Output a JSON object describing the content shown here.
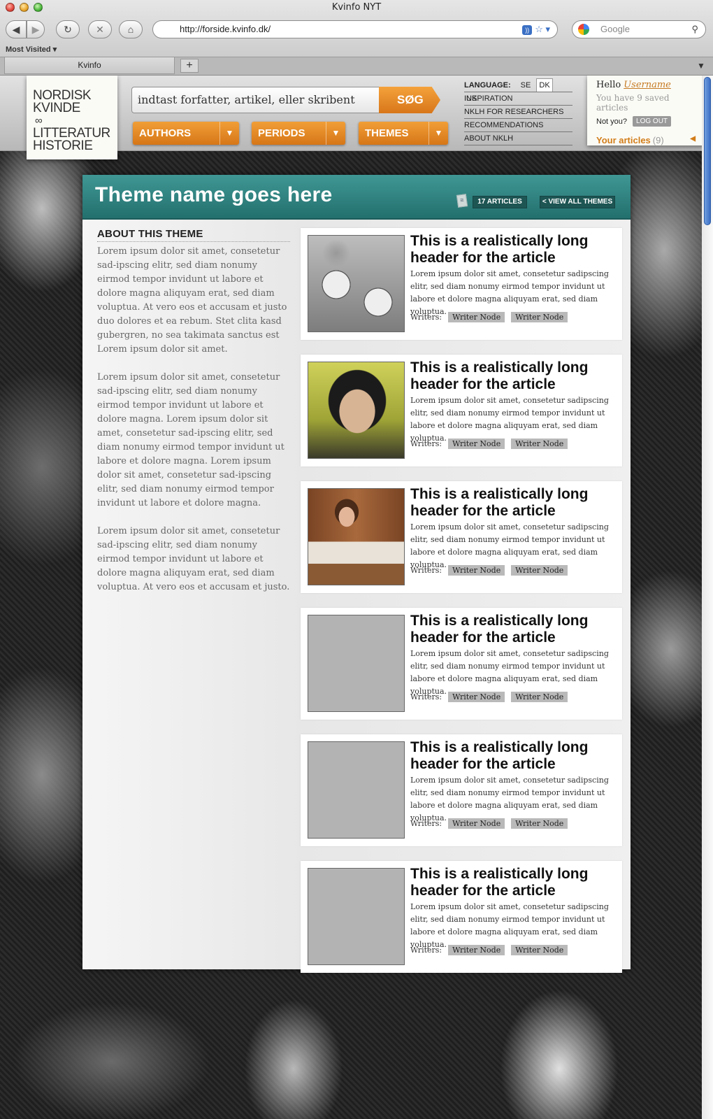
{
  "browser": {
    "window_title": "Kvinfo NYT",
    "url": "http://forside.kvinfo.dk/",
    "search_placeholder": "Google",
    "bookmarks_label": "Most Visited ▾",
    "tab_title": "Kvinfo",
    "new_tab_label": "+"
  },
  "site": {
    "logo_lines": [
      "NORDISK",
      "KVINDE",
      "LITTERATUR",
      "HISTORIE"
    ],
    "search_placeholder": "indtast forfatter, artikel, eller skribent",
    "search_button": "SØG",
    "nav": [
      {
        "label": "AUTHORS"
      },
      {
        "label": "PERIODS"
      },
      {
        "label": "THEMES"
      }
    ],
    "language_label": "LANGUAGE:",
    "languages": [
      "SE",
      "DK",
      "UK"
    ],
    "active_language": "DK",
    "header_links": [
      "INSPIRATION",
      "NKLH FOR RESEARCHERS",
      "RECOMMENDATIONS",
      "ABOUT NKLH"
    ],
    "user": {
      "hello": "Hello",
      "username": "Username",
      "saved_text": "You have 9 saved articles",
      "not_you": "Not you?",
      "logout": "LOG OUT",
      "your_articles": "Your articles",
      "your_articles_count": "(9)"
    }
  },
  "theme": {
    "title": "Theme name goes here",
    "article_count": "17 ARTICLES",
    "view_all": "< VIEW ALL THEMES",
    "about_heading": "ABOUT THIS THEME",
    "about_paragraphs": [
      "Lorem ipsum dolor sit amet, consetetur sad-ipscing elitr, sed diam nonumy eirmod tempor invidunt ut labore et dolore magna aliquyam erat, sed diam voluptua. At vero eos et accusam et justo duo dolores et ea rebum. Stet clita kasd gubergren, no sea takimata sanctus est Lorem ipsum dolor sit amet.",
      "Lorem ipsum dolor sit amet, consetetur sad-ipscing elitr, sed diam nonumy eirmod tempor invidunt ut labore et dolore magna. Lorem ipsum dolor sit amet, consetetur sad-ipscing elitr, sed diam nonumy eirmod tempor invidunt ut labore et dolore magna. Lorem ipsum dolor sit amet, consetetur sad-ipscing elitr, sed diam nonumy eirmod tempor invidunt ut labore et dolore magna.",
      "Lorem ipsum dolor sit amet, consetetur sad-ipscing elitr, sed diam nonumy eirmod tempor invidunt ut labore et dolore magna aliquyam erat, sed diam voluptua. At vero eos et accusam et justo."
    ]
  },
  "articles": [
    {
      "title": "This is a realistically long header for the article",
      "body": "Lorem ipsum dolor sit amet, consetetur sadipscing elitr, sed diam nonumy eirmod tempor invidunt ut labore et dolore magna aliquyam erat, sed diam voluptua.",
      "writers_label": "Writers:",
      "writers": [
        "Writer Node",
        "Writer Node"
      ],
      "image": "strike-photo"
    },
    {
      "title": "This is a realistically long header for the article",
      "body": "Lorem ipsum dolor sit amet, consetetur sadipscing elitr, sed diam nonumy eirmod tempor invidunt ut labore et dolore magna aliquyam erat, sed diam voluptua.",
      "writers_label": "Writers:",
      "writers": [
        "Writer Node",
        "Writer Node"
      ],
      "image": "smiling-woman-photo"
    },
    {
      "title": "This is a realistically long header for the article",
      "body": "Lorem ipsum dolor sit amet, consetetur sadipscing elitr, sed diam nonumy eirmod tempor invidunt ut labore et dolore magna aliquyam erat, sed diam voluptua.",
      "writers_label": "Writers:",
      "writers": [
        "Writer Node",
        "Writer Node"
      ],
      "image": "woman-at-desk-photo"
    },
    {
      "title": "This is a realistically long header for the article",
      "body": "Lorem ipsum dolor sit amet, consetetur sadipscing elitr, sed diam nonumy eirmod tempor invidunt ut labore et dolore magna aliquyam erat, sed diam voluptua.",
      "writers_label": "Writers:",
      "writers": [
        "Writer Node",
        "Writer Node"
      ],
      "image": "placeholder"
    },
    {
      "title": "This is a realistically long header for the article",
      "body": "Lorem ipsum dolor sit amet, consetetur sadipscing elitr, sed diam nonumy eirmod tempor invidunt ut labore et dolore magna aliquyam erat, sed diam voluptua.",
      "writers_label": "Writers:",
      "writers": [
        "Writer Node",
        "Writer Node"
      ],
      "image": "placeholder"
    },
    {
      "title": "This is a realistically long header for the article",
      "body": "Lorem ipsum dolor sit amet, consetetur sadipscing elitr, sed diam nonumy eirmod tempor invidunt ut labore et dolore magna aliquyam erat, sed diam voluptua.",
      "writers_label": "Writers:",
      "writers": [
        "Writer Node",
        "Writer Node"
      ],
      "image": "placeholder"
    }
  ],
  "colors": {
    "accent_orange": "#e48a27",
    "theme_teal": "#2f8583",
    "username_orange": "#c67a22"
  }
}
